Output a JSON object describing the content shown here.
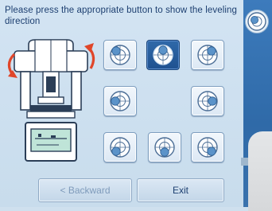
{
  "instruction": "Please press the appropriate button to show the leveling direction",
  "buttons": {
    "backward": "< Backward",
    "exit": "Exit"
  },
  "leveling_grid": {
    "selected": "top",
    "directions": [
      "top-left",
      "top",
      "top-right",
      "left",
      "right",
      "bottom-left",
      "bottom",
      "bottom-right"
    ]
  },
  "side_icon": "level-bubble-icon",
  "colors": {
    "panel": "#d3e4f3",
    "accent": "#2f69a9",
    "arrow": "#e0462a",
    "text": "#1d3f70"
  }
}
